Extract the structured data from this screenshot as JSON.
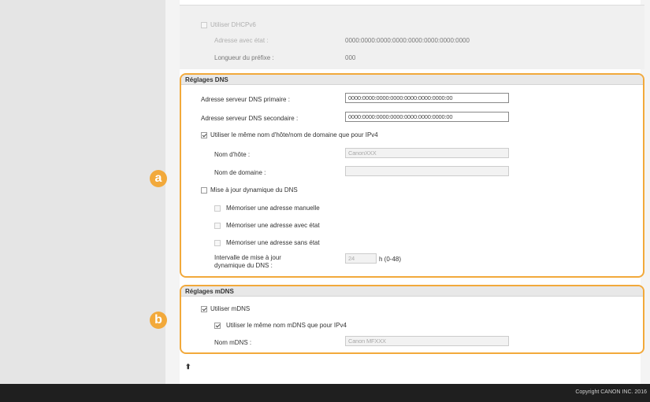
{
  "ipv6": {
    "dhcpv6_label": "Utiliser DHCPv6",
    "stateful_address_label": "Adresse avec état :",
    "stateful_address_value": "0000:0000:0000:0000:0000:0000:0000:0000",
    "prefix_length_label": "Longueur du préfixe :",
    "prefix_length_value": "000"
  },
  "dns": {
    "title": "Réglages DNS",
    "primary_label": "Adresse serveur DNS primaire :",
    "primary_value": "0000:0000:0000:0000:0000:0000:0000:00",
    "secondary_label": "Adresse serveur DNS secondaire :",
    "secondary_value": "0000:0000:0000:0000:0000:0000:0000:00",
    "same_name_label": "Utiliser le même nom d'hôte/nom de domaine que pour IPv4",
    "host_label": "Nom d'hôte :",
    "host_value": "CanonXXX",
    "domain_label": "Nom de domaine :",
    "domain_value": "",
    "dynamic_update_label": "Mise à jour dynamique du DNS",
    "manual_label": "Mémoriser une adresse manuelle",
    "stateful_label": "Mémoriser une adresse avec état",
    "stateless_label": "Mémoriser une adresse sans état",
    "interval_label_1": "Intervalle de mise à jour",
    "interval_label_2": "dynamique du DNS :",
    "interval_value": "24",
    "interval_unit": "h (0-48)"
  },
  "mdns": {
    "title": "Réglages mDNS",
    "use_label": "Utiliser mDNS",
    "same_name_label": "Utiliser le même nom mDNS que pour IPv4",
    "name_label": "Nom mDNS :",
    "name_value": "Canon MFXXX"
  },
  "markers": {
    "a": "a",
    "b": "b"
  },
  "top_link": "⬆",
  "footer": {
    "copyright": "Copyright CANON INC. 2016"
  },
  "colors": {
    "accent": "#f2a93b",
    "footer_bg": "#1f1f1f"
  }
}
